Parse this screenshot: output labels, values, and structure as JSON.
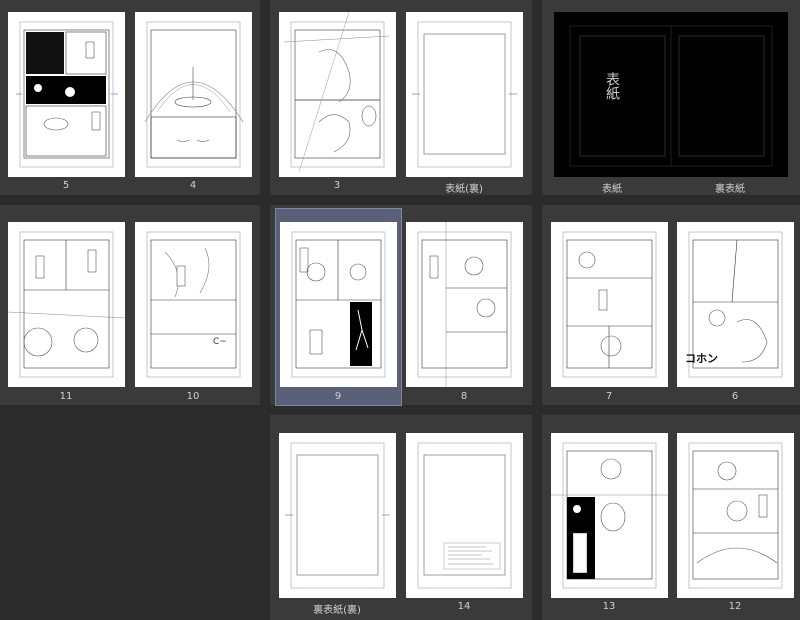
{
  "spreads": [
    {
      "pages": [
        {
          "label": "5"
        },
        {
          "label": "4"
        }
      ]
    },
    {
      "pages": [
        {
          "label": "3"
        },
        {
          "label": "表紙(裏)"
        }
      ]
    },
    {
      "pages": [
        {
          "label": "表紙",
          "handwriting": "表紙"
        },
        {
          "label": "裏表紙"
        }
      ]
    },
    {
      "pages": [
        {
          "label": "11"
        },
        {
          "label": "10"
        }
      ]
    },
    {
      "pages": [
        {
          "label": "9",
          "selected": true
        },
        {
          "label": "8"
        }
      ]
    },
    {
      "pages": [
        {
          "label": "7"
        },
        {
          "label": "6"
        }
      ]
    },
    {
      "pages": [
        {
          "label": "裏表紙(裏)"
        },
        {
          "label": "14"
        }
      ]
    },
    {
      "pages": [
        {
          "label": "13"
        },
        {
          "label": "12"
        }
      ]
    }
  ],
  "sound_effect": "コホン"
}
